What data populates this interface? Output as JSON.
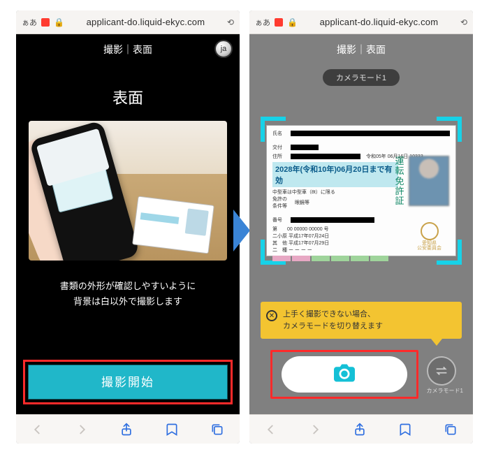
{
  "browser": {
    "aa": "ぁあ",
    "url": "applicant-do.liquid-ekyc.com"
  },
  "left": {
    "header": "撮影｜表面",
    "lang": "ja",
    "title": "表面",
    "instruction_line1": "書類の外形が確認しやすいように",
    "instruction_line2": "背景は白以外で撮影します",
    "start_button": "撮影開始"
  },
  "right": {
    "header": "撮影｜表面",
    "mode_pill": "カメラモード1",
    "id": {
      "name_lbl": "氏名",
      "addr_lbl": "住所",
      "dates_line": "令和05年 06月16日  10333",
      "expiry": "2028年(令和10年)06月20日まで有効",
      "cond1": "中型車は中型車（8t）に限る",
      "cond_lbl": "免許の\n条件等",
      "glasses": "眼鏡等",
      "num_lbl": "番号",
      "num_val": "第　　00  00000  00000  号",
      "line1": "二小原 平成17年07月24日",
      "line2": "其　他 平成17年07月29日",
      "line3": "二　種 ー ー ー ー",
      "vlabel": "運転免許証",
      "mark_lbl": "交付",
      "seal1": "愛知県",
      "seal2": "公安委員会"
    },
    "hint_line1": "上手く撮影できない場合、",
    "hint_line2": "カメラモードを切り替えます",
    "mode_switch_label": "カメラモード1"
  }
}
